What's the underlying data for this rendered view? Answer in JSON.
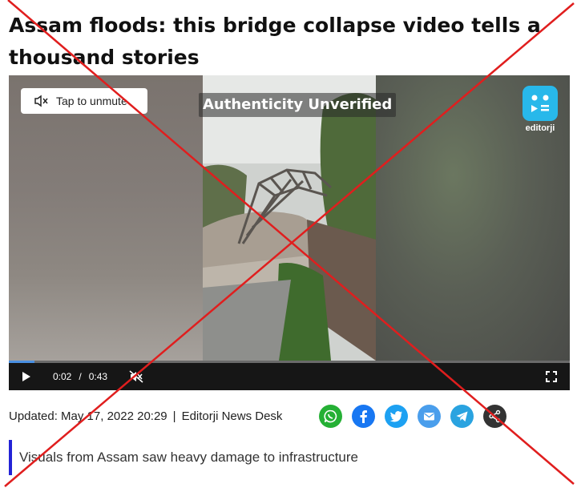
{
  "article": {
    "headline": "Assam floods: this bridge collapse video tells a thousand stories",
    "updated": "Updated: May 17, 2022 20:29",
    "separator": "|",
    "source": "Editorji News Desk",
    "summary": "Visuals from Assam saw heavy damage to infrastructure"
  },
  "video": {
    "unmute_label": "Tap to unmute",
    "overlay_label": "Authenticity Unverified",
    "brand_name": "editorji",
    "current_time": "0:02",
    "time_separator": "/",
    "duration": "0:43",
    "progress_fraction": 0.046,
    "muted": true
  },
  "share": [
    {
      "name": "whatsapp",
      "icon": "whatsapp-icon",
      "color": "#25b035"
    },
    {
      "name": "facebook",
      "icon": "facebook-icon",
      "color": "#1877f2"
    },
    {
      "name": "twitter",
      "icon": "twitter-icon",
      "color": "#1da1f2"
    },
    {
      "name": "email",
      "icon": "email-icon",
      "color": "#4a9eec"
    },
    {
      "name": "telegram",
      "icon": "telegram-icon",
      "color": "#2aa3e0"
    },
    {
      "name": "share",
      "icon": "share-icon",
      "color": "#333333"
    }
  ],
  "colors": {
    "accent_bar": "#2323d6",
    "progress": "#4a90e2",
    "cross_overlay": "#e01e1e",
    "brand_logo": "#28b8ea"
  }
}
